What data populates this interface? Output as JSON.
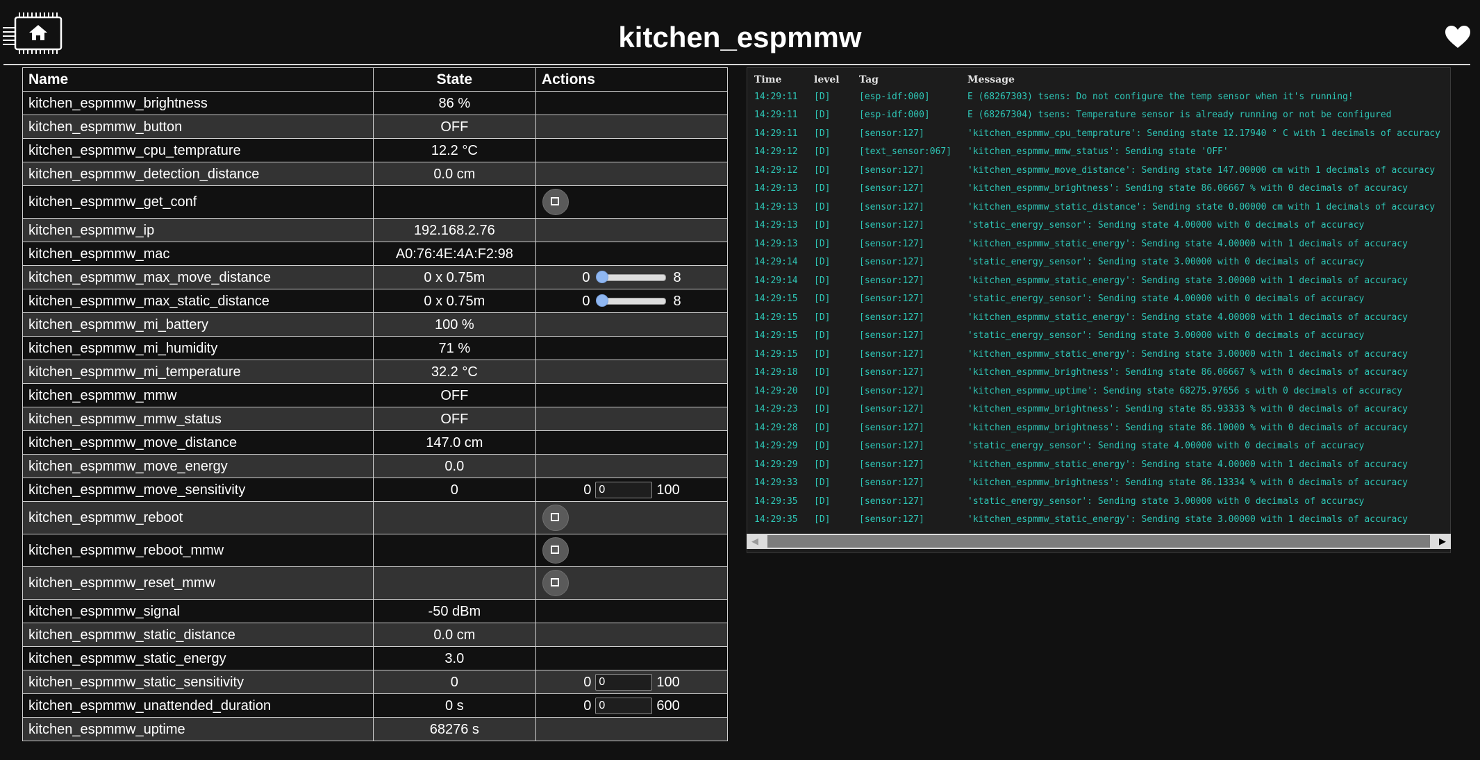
{
  "header": {
    "title": "kitchen_espmmw"
  },
  "table": {
    "headers": {
      "name": "Name",
      "state": "State",
      "actions": "Actions"
    },
    "rows": [
      {
        "name": "kitchen_espmmw_brightness",
        "state": "86 %"
      },
      {
        "name": "kitchen_espmmw_button",
        "state": "OFF"
      },
      {
        "name": "kitchen_espmmw_cpu_temprature",
        "state": "12.2 °C"
      },
      {
        "name": "kitchen_espmmw_detection_distance",
        "state": "0.0 cm"
      },
      {
        "name": "kitchen_espmmw_get_conf",
        "state": "",
        "action": "button"
      },
      {
        "name": "kitchen_espmmw_ip",
        "state": "192.168.2.76"
      },
      {
        "name": "kitchen_espmmw_mac",
        "state": "A0:76:4E:4A:F2:98"
      },
      {
        "name": "kitchen_espmmw_max_move_distance",
        "state": "0 x 0.75m",
        "action": "slider",
        "min": "0",
        "max": "8",
        "value": 0
      },
      {
        "name": "kitchen_espmmw_max_static_distance",
        "state": "0 x 0.75m",
        "action": "slider",
        "min": "0",
        "max": "8",
        "value": 0
      },
      {
        "name": "kitchen_espmmw_mi_battery",
        "state": "100 %"
      },
      {
        "name": "kitchen_espmmw_mi_humidity",
        "state": "71 %"
      },
      {
        "name": "kitchen_espmmw_mi_temperature",
        "state": "32.2 °C"
      },
      {
        "name": "kitchen_espmmw_mmw",
        "state": "OFF"
      },
      {
        "name": "kitchen_espmmw_mmw_status",
        "state": "OFF"
      },
      {
        "name": "kitchen_espmmw_move_distance",
        "state": "147.0 cm"
      },
      {
        "name": "kitchen_espmmw_move_energy",
        "state": "0.0"
      },
      {
        "name": "kitchen_espmmw_move_sensitivity",
        "state": "0",
        "action": "number",
        "min": "0",
        "max": "100",
        "value": "0"
      },
      {
        "name": "kitchen_espmmw_reboot",
        "state": "",
        "action": "button"
      },
      {
        "name": "kitchen_espmmw_reboot_mmw",
        "state": "",
        "action": "button"
      },
      {
        "name": "kitchen_espmmw_reset_mmw",
        "state": "",
        "action": "button"
      },
      {
        "name": "kitchen_espmmw_signal",
        "state": "-50 dBm"
      },
      {
        "name": "kitchen_espmmw_static_distance",
        "state": "0.0 cm"
      },
      {
        "name": "kitchen_espmmw_static_energy",
        "state": "3.0"
      },
      {
        "name": "kitchen_espmmw_static_sensitivity",
        "state": "0",
        "action": "number",
        "min": "0",
        "max": "100",
        "value": "0"
      },
      {
        "name": "kitchen_espmmw_unattended_duration",
        "state": "0 s",
        "action": "number",
        "min": "0",
        "max": "600",
        "value": "0"
      },
      {
        "name": "kitchen_espmmw_uptime",
        "state": "68276 s"
      }
    ]
  },
  "log": {
    "headers": {
      "time": "Time",
      "level": "level",
      "tag": "Tag",
      "message": "Message"
    },
    "entries": [
      {
        "time": "14:29:11",
        "level": "[D]",
        "tag": "[esp-idf:000]",
        "message": "E (68267303) tsens: Do not configure the temp sensor when it's running!"
      },
      {
        "time": "14:29:11",
        "level": "[D]",
        "tag": "[esp-idf:000]",
        "message": "E (68267304) tsens: Temperature sensor is already running or not be configured"
      },
      {
        "time": "14:29:11",
        "level": "[D]",
        "tag": "[sensor:127]",
        "message": "'kitchen_espmmw_cpu_temprature': Sending state 12.17940 ° C with 1 decimals of accuracy"
      },
      {
        "time": "14:29:12",
        "level": "[D]",
        "tag": "[text_sensor:067]",
        "message": "'kitchen_espmmw_mmw_status': Sending state 'OFF'"
      },
      {
        "time": "14:29:12",
        "level": "[D]",
        "tag": "[sensor:127]",
        "message": "'kitchen_espmmw_move_distance': Sending state 147.00000 cm with 1 decimals of accuracy"
      },
      {
        "time": "14:29:13",
        "level": "[D]",
        "tag": "[sensor:127]",
        "message": "'kitchen_espmmw_brightness': Sending state 86.06667 % with 0 decimals of accuracy"
      },
      {
        "time": "14:29:13",
        "level": "[D]",
        "tag": "[sensor:127]",
        "message": "'kitchen_espmmw_static_distance': Sending state 0.00000 cm with 1 decimals of accuracy"
      },
      {
        "time": "14:29:13",
        "level": "[D]",
        "tag": "[sensor:127]",
        "message": "'static_energy_sensor': Sending state 4.00000  with 0 decimals of accuracy"
      },
      {
        "time": "14:29:13",
        "level": "[D]",
        "tag": "[sensor:127]",
        "message": "'kitchen_espmmw_static_energy': Sending state 4.00000  with 1 decimals of accuracy"
      },
      {
        "time": "14:29:14",
        "level": "[D]",
        "tag": "[sensor:127]",
        "message": "'static_energy_sensor': Sending state 3.00000  with 0 decimals of accuracy"
      },
      {
        "time": "14:29:14",
        "level": "[D]",
        "tag": "[sensor:127]",
        "message": "'kitchen_espmmw_static_energy': Sending state 3.00000  with 1 decimals of accuracy"
      },
      {
        "time": "14:29:15",
        "level": "[D]",
        "tag": "[sensor:127]",
        "message": "'static_energy_sensor': Sending state 4.00000  with 0 decimals of accuracy"
      },
      {
        "time": "14:29:15",
        "level": "[D]",
        "tag": "[sensor:127]",
        "message": "'kitchen_espmmw_static_energy': Sending state 4.00000  with 1 decimals of accuracy"
      },
      {
        "time": "14:29:15",
        "level": "[D]",
        "tag": "[sensor:127]",
        "message": "'static_energy_sensor': Sending state 3.00000  with 0 decimals of accuracy"
      },
      {
        "time": "14:29:15",
        "level": "[D]",
        "tag": "[sensor:127]",
        "message": "'kitchen_espmmw_static_energy': Sending state 3.00000  with 1 decimals of accuracy"
      },
      {
        "time": "14:29:18",
        "level": "[D]",
        "tag": "[sensor:127]",
        "message": "'kitchen_espmmw_brightness': Sending state 86.06667 % with 0 decimals of accuracy"
      },
      {
        "time": "14:29:20",
        "level": "[D]",
        "tag": "[sensor:127]",
        "message": "'kitchen_espmmw_uptime': Sending state 68275.97656 s with 0 decimals of accuracy"
      },
      {
        "time": "14:29:23",
        "level": "[D]",
        "tag": "[sensor:127]",
        "message": "'kitchen_espmmw_brightness': Sending state 85.93333 % with 0 decimals of accuracy"
      },
      {
        "time": "14:29:28",
        "level": "[D]",
        "tag": "[sensor:127]",
        "message": "'kitchen_espmmw_brightness': Sending state 86.10000 % with 0 decimals of accuracy"
      },
      {
        "time": "14:29:29",
        "level": "[D]",
        "tag": "[sensor:127]",
        "message": "'static_energy_sensor': Sending state 4.00000  with 0 decimals of accuracy"
      },
      {
        "time": "14:29:29",
        "level": "[D]",
        "tag": "[sensor:127]",
        "message": "'kitchen_espmmw_static_energy': Sending state 4.00000  with 1 decimals of accuracy"
      },
      {
        "time": "14:29:33",
        "level": "[D]",
        "tag": "[sensor:127]",
        "message": "'kitchen_espmmw_brightness': Sending state 86.13334 % with 0 decimals of accuracy"
      },
      {
        "time": "14:29:35",
        "level": "[D]",
        "tag": "[sensor:127]",
        "message": "'static_energy_sensor': Sending state 3.00000  with 0 decimals of accuracy"
      },
      {
        "time": "14:29:35",
        "level": "[D]",
        "tag": "[sensor:127]",
        "message": "'kitchen_espmmw_static_energy': Sending state 3.00000  with 1 decimals of accuracy"
      }
    ]
  },
  "icons": {
    "logo": "home-chip-icon",
    "heart": "heart-icon",
    "button": "square-stop-icon",
    "scroll_left": "arrow-left-icon",
    "scroll_right": "arrow-right-icon"
  },
  "colors": {
    "background": "#111111",
    "row_alt": "#333333",
    "log_text": "#2ec6b6",
    "slider_thumb": "#8fb7f2"
  }
}
